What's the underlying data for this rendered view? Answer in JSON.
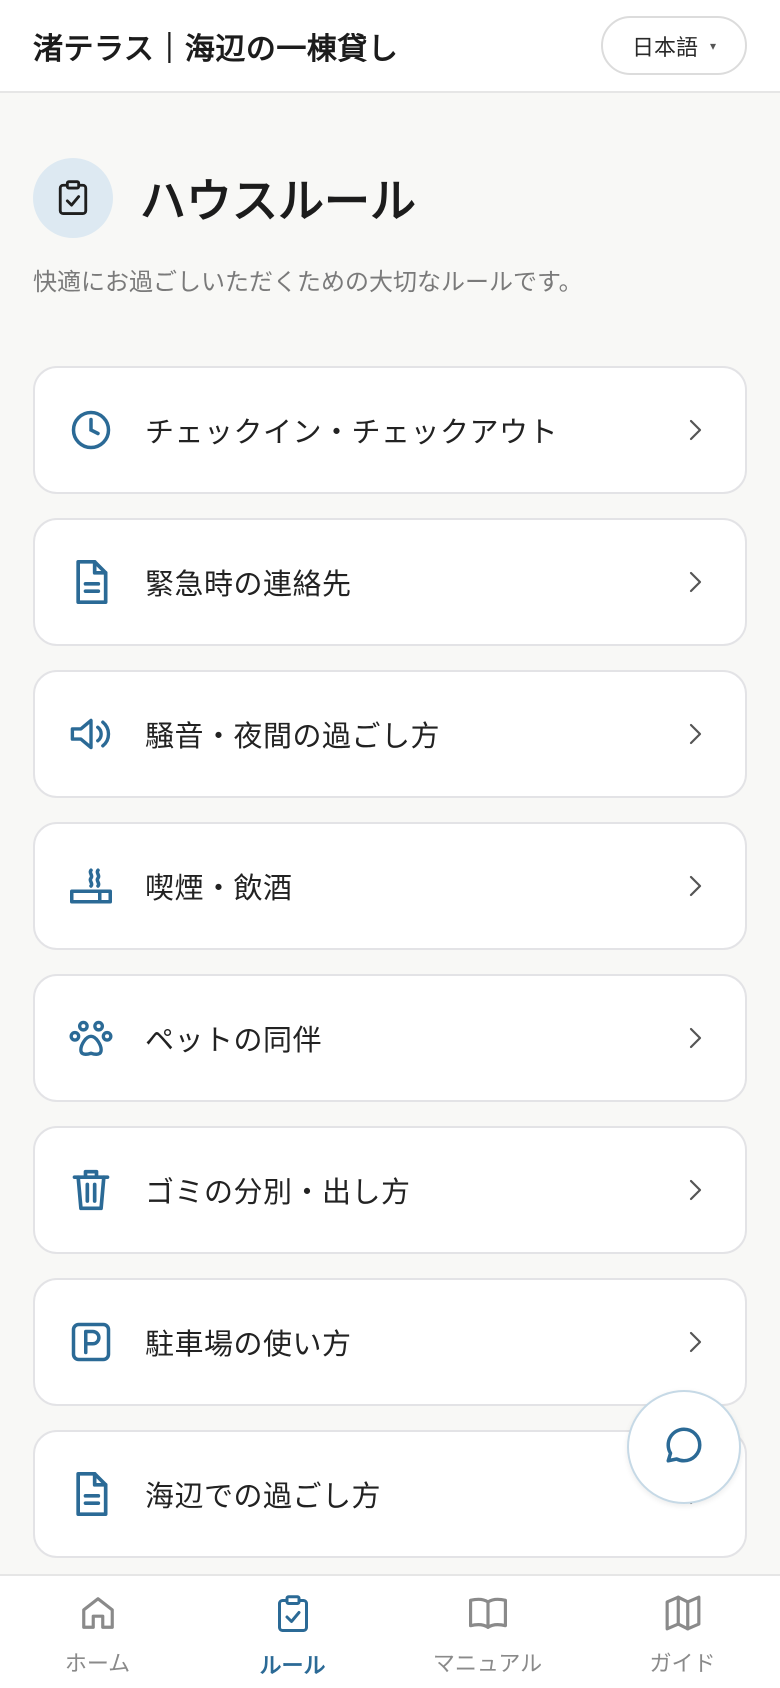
{
  "header": {
    "title": "渚テラス｜海辺の一棟貸し",
    "language": {
      "selected": "日本語",
      "caret": "▾"
    }
  },
  "page": {
    "icon": "clipboard-check-icon",
    "title": "ハウスルール",
    "subtitle": "快適にお過ごしいただくための大切なルールです。"
  },
  "rules": [
    {
      "label": "チェックイン・チェックアウト",
      "icon": "clock-icon"
    },
    {
      "label": "緊急時の連絡先",
      "icon": "document-icon"
    },
    {
      "label": "騒音・夜間の過ごし方",
      "icon": "speaker-icon"
    },
    {
      "label": "喫煙・飲酒",
      "icon": "smoking-icon"
    },
    {
      "label": "ペットの同伴",
      "icon": "paw-icon"
    },
    {
      "label": "ゴミの分別・出し方",
      "icon": "trash-icon"
    },
    {
      "label": "駐車場の使い方",
      "icon": "parking-icon"
    },
    {
      "label": "海辺での過ごし方",
      "icon": "document-icon"
    }
  ],
  "chat": {
    "icon": "chat-bubble-icon"
  },
  "nav": {
    "items": [
      {
        "label": "ホーム",
        "icon": "home-icon",
        "active": false
      },
      {
        "label": "ルール",
        "icon": "clipboard-check-icon",
        "active": true
      },
      {
        "label": "マニュアル",
        "icon": "book-icon",
        "active": false
      },
      {
        "label": "ガイド",
        "icon": "map-icon",
        "active": false
      }
    ]
  },
  "colors": {
    "accent": "#2b6a96",
    "icon_bg": "#dde9f2",
    "background": "#f8f8f6"
  }
}
